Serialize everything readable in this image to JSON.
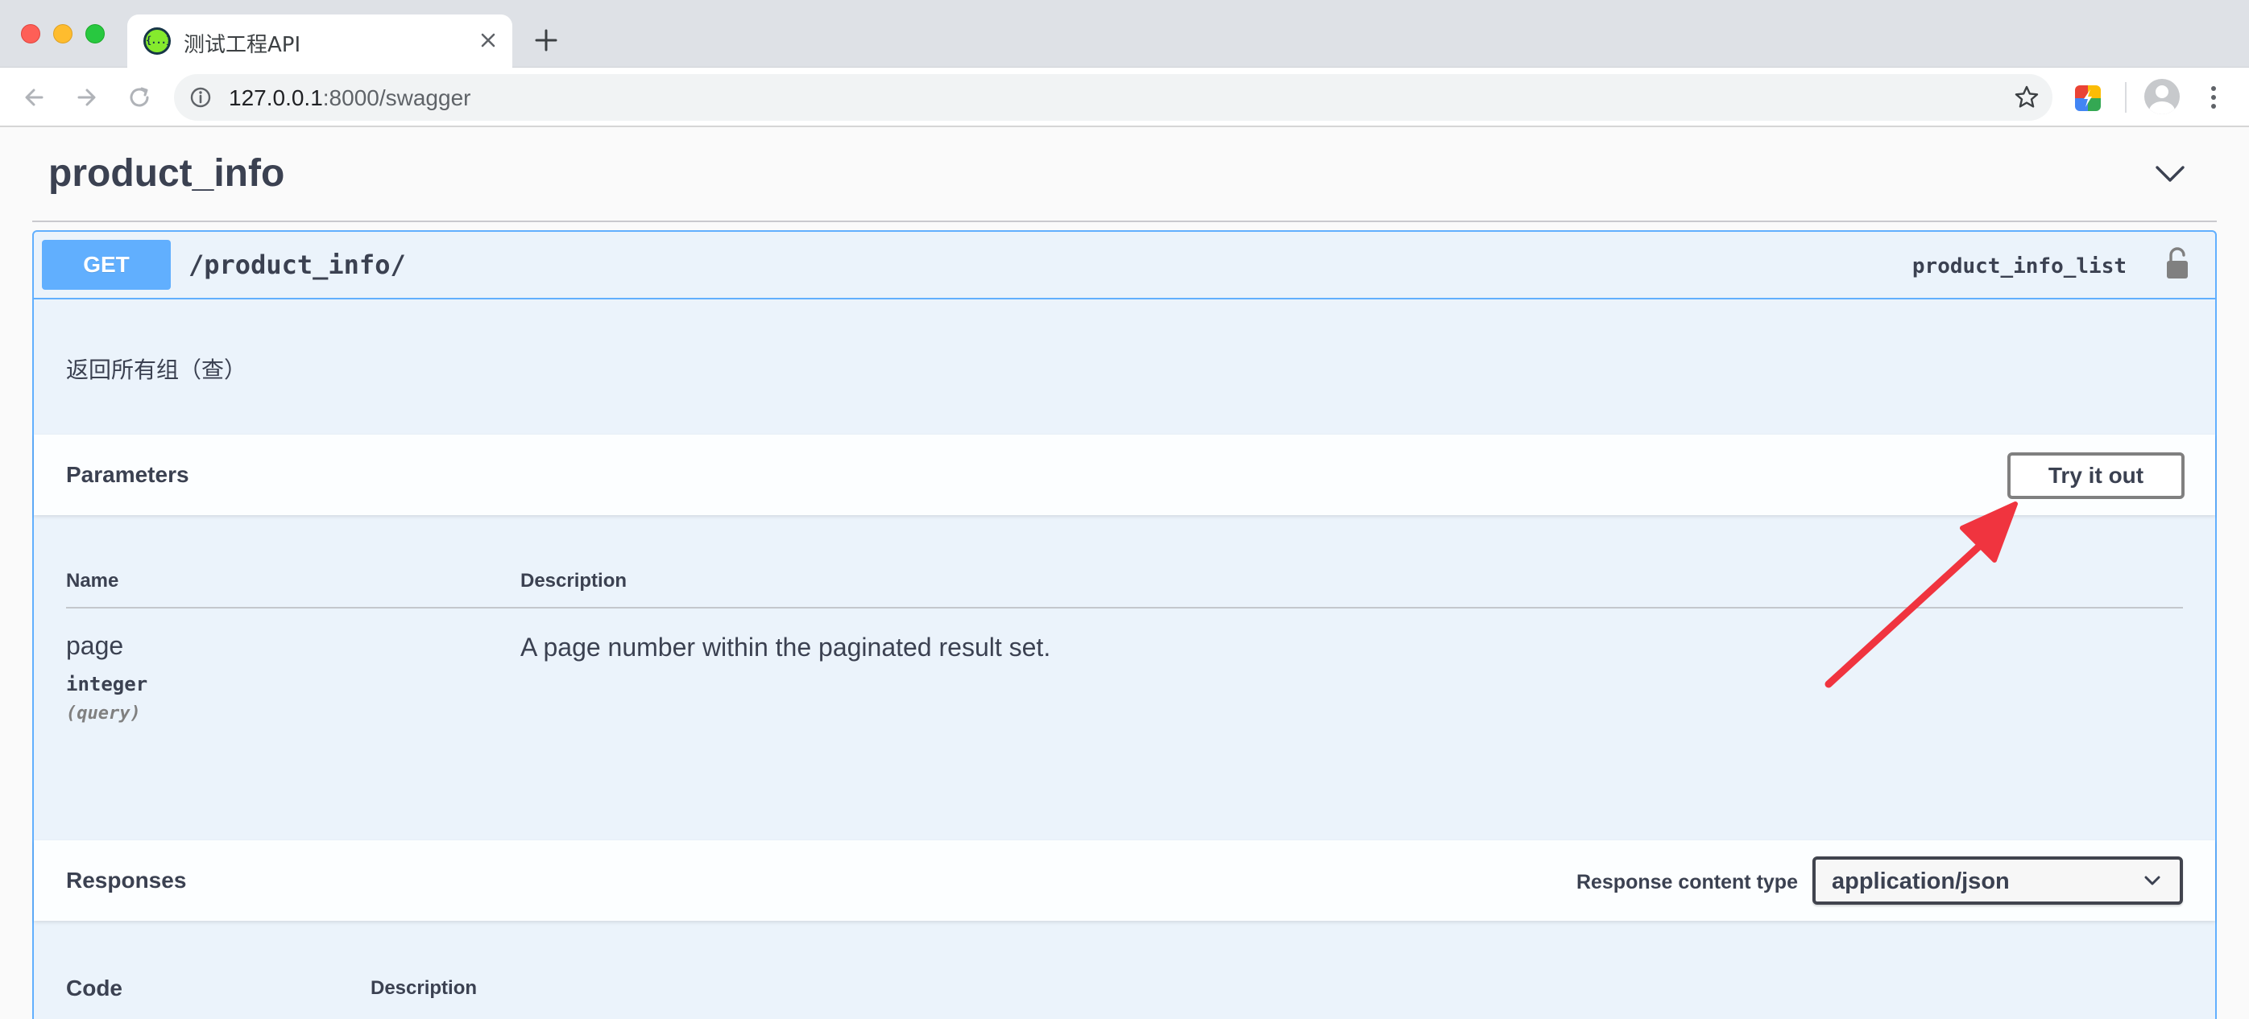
{
  "browser": {
    "tab_title": "测试工程API",
    "url_host": "127.0.0.1",
    "url_rest": ":8000/swagger"
  },
  "swagger": {
    "tag": "product_info",
    "operation": {
      "method": "GET",
      "path": "/product_info/",
      "operation_id": "product_info_list",
      "description": "返回所有组（查）"
    },
    "parameters": {
      "title": "Parameters",
      "try_it_out_label": "Try it out",
      "column_name": "Name",
      "column_description": "Description",
      "items": [
        {
          "name": "page",
          "type": "integer",
          "in": "(query)",
          "description": "A page number within the paginated result set."
        }
      ]
    },
    "responses": {
      "title": "Responses",
      "content_type_label": "Response content type",
      "content_type_value": "application/json",
      "column_code": "Code",
      "column_description": "Description"
    }
  },
  "annotation": {
    "arrow_color": "#f0343f"
  },
  "colors": {
    "get_blue": "#61affe",
    "opblock_bg": "#ebf3fb"
  }
}
